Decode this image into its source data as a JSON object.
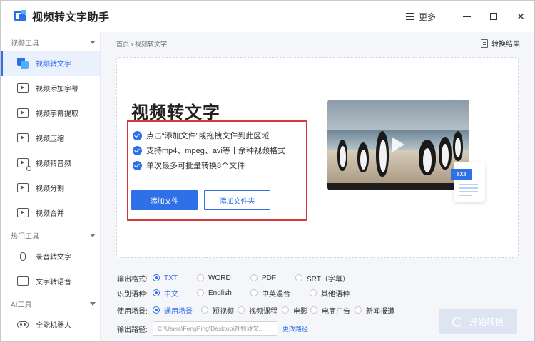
{
  "app": {
    "title": "视频转文字助手",
    "menu_label": "更多"
  },
  "sidebar": {
    "groups": [
      {
        "label": "视频工具",
        "items": [
          "视频转文字",
          "视频添加字幕",
          "视频字幕提取",
          "视频压缩",
          "视频转音频",
          "视频分割",
          "视频合并"
        ]
      },
      {
        "label": "热门工具",
        "items": [
          "录音转文字",
          "文字转语音"
        ]
      },
      {
        "label": "AI工具",
        "items": [
          "全能机器人"
        ]
      }
    ]
  },
  "main": {
    "breadcrumb": "首页 › 视频转文字",
    "result_link": "转换结果",
    "drop": {
      "title": "视频转文字",
      "features": [
        "点击“添加文件”或拖拽文件到此区域",
        "支持mp4、mpeg、avi等十余种视频格式",
        "单次最多可批量转换8个文件"
      ],
      "add_file": "添加文件",
      "add_folder": "添加文件夹",
      "file_badge": "TXT"
    },
    "options": {
      "format": {
        "label": "输出格式:",
        "choices": [
          "TXT",
          "WORD",
          "PDF",
          "SRT（字幕）"
        ],
        "selected": "TXT"
      },
      "language": {
        "label": "识别语种:",
        "choices": [
          "中文",
          "English",
          "中英混合",
          "其他语种"
        ],
        "selected": "中文"
      },
      "scene": {
        "label": "使用场景:",
        "choices": [
          "通用场景",
          "短视频",
          "视频课程",
          "电影",
          "电商广告",
          "新闻报道"
        ],
        "selected": "通用场景"
      },
      "path": {
        "label": "输出路径:",
        "value": "C:\\Users\\FengPing\\Desktop\\视频转文...",
        "change": "更改路径"
      }
    },
    "start_button": "开始转换"
  },
  "colors": {
    "accent": "#2f6fe8",
    "highlight_box": "#d9363e",
    "disabled_button": "#dde5f2"
  }
}
